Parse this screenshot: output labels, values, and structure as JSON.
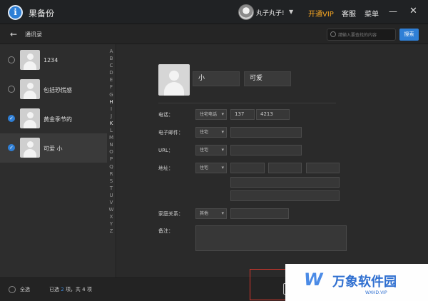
{
  "app": {
    "title": "果备份",
    "logo_glyph": "i"
  },
  "user": {
    "name": "丸子丸子!",
    "caret": "▼"
  },
  "header": {
    "vip": "开通VIP",
    "service": "客服",
    "menu": "菜单",
    "minimize": "—",
    "close": "✕"
  },
  "toolbar": {
    "back_icon": "←",
    "title": "通讯录",
    "search_placeholder": "請输入要查找的内容",
    "search_button": "搜索"
  },
  "contacts": [
    {
      "name": "1234",
      "selected": false
    },
    {
      "name": "包括恐慌感",
      "selected": false
    },
    {
      "name": "黄金季节的",
      "selected": true
    },
    {
      "name": "可爱 小",
      "selected": true
    }
  ],
  "alphabet": [
    "A",
    "B",
    "C",
    "D",
    "E",
    "F",
    "G",
    "H",
    "I",
    "J",
    "K",
    "L",
    "M",
    "N",
    "O",
    "P",
    "Q",
    "R",
    "S",
    "T",
    "U",
    "V",
    "W",
    "X",
    "Y",
    "Z"
  ],
  "alphabet_active": [
    "H",
    "K"
  ],
  "detail": {
    "last_name": "小",
    "first_name": "可爱",
    "phone": {
      "label": "电话：",
      "type": "住宅电话",
      "area": "137",
      "number": "4213"
    },
    "email": {
      "label": "电子邮件：",
      "type": "住宅",
      "value": ""
    },
    "url": {
      "label": "URL：",
      "type": "住宅",
      "value": ""
    },
    "address": {
      "label": "地址：",
      "type": "住宅"
    },
    "family": {
      "label": "家庭关系：",
      "type": "其他",
      "value": ""
    },
    "notes": {
      "label": "备注：",
      "value": ""
    }
  },
  "footer": {
    "select_all": "全选",
    "selected_prefix": "已选",
    "selected_count": "2",
    "selected_suffix": "项，共 4 项"
  },
  "watermark": {
    "logo": "W",
    "title": "万象软件园",
    "url": "WXHD.VIP"
  },
  "colors": {
    "accent": "#2f7fd6",
    "vip": "#f5a623",
    "highlight": "#d9362b"
  }
}
